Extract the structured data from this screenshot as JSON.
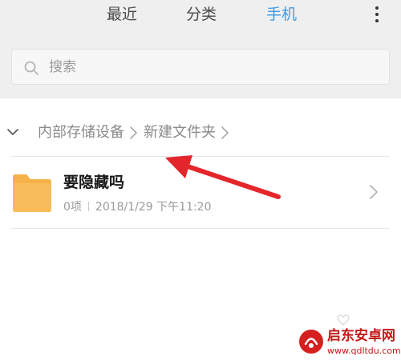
{
  "tabs": {
    "recent": "最近",
    "category": "分类",
    "phone": "手机",
    "active": "手机"
  },
  "search": {
    "placeholder": "搜索"
  },
  "breadcrumb": {
    "items": [
      "内部存储设备",
      "新建文件夹"
    ]
  },
  "folder": {
    "name": "要隐藏吗",
    "count": "0项",
    "modified": "2018/1/29 下午11:20"
  },
  "watermark": {
    "title": "启东安卓网",
    "url": "www.qdltdu.com"
  },
  "colors": {
    "active_tab": "#3d9ae8",
    "folder": "#f6b24a",
    "annotation_arrow": "#e3262b",
    "watermark": "#c41616"
  },
  "icons": [
    "more-vertical-icon",
    "search-icon",
    "chevron-down-icon",
    "chevron-right-icon",
    "folder-icon",
    "annotation-arrow"
  ]
}
